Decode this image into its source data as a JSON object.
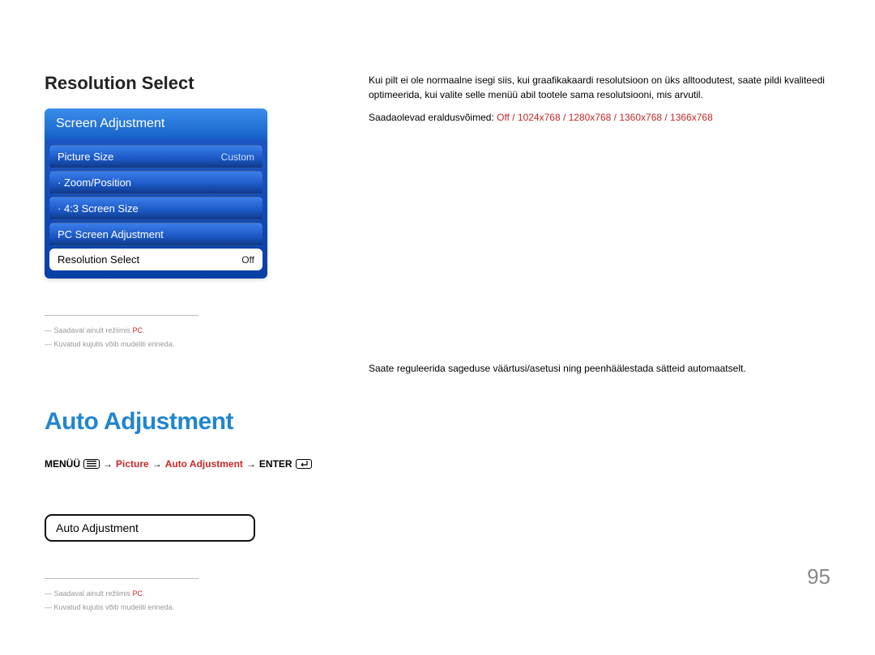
{
  "section1": {
    "title": "Resolution Select",
    "menu": {
      "header": "Screen Adjustment",
      "items": [
        {
          "label": "Picture Size",
          "value": "Custom"
        },
        {
          "label": "· Zoom/Position",
          "value": ""
        },
        {
          "label": "· 4:3 Screen Size",
          "value": ""
        },
        {
          "label": "PC Screen Adjustment",
          "value": ""
        },
        {
          "label": "Resolution Select",
          "value": "Off",
          "selected": true
        }
      ]
    },
    "footnotes": {
      "a_prefix": "― Saadaval ainult režiimis ",
      "a_red": "PC",
      "a_suffix": ".",
      "b": "― Kuvatud kujutis võib mudeliti erineda."
    },
    "body": {
      "p1": "Kui pilt ei ole normaalne isegi siis, kui graafikakaardi resolutsioon on üks alltoodutest, saate pildi kvaliteedi optimeerida, kui valite selle menüü abil tootele sama resolutsiooni, mis arvutil.",
      "p2_prefix": "Saadaolevad eraldusvõimed: ",
      "p2_resolutions": "Off / 1024x768 / 1280x768 / 1360x768 / 1366x768"
    }
  },
  "section2": {
    "title": "Auto Adjustment",
    "breadcrumb": {
      "menu_word": "MENÜÜ",
      "picture": "Picture",
      "auto": "Auto Adjustment",
      "enter": "ENTER"
    },
    "button": "Auto Adjustment",
    "body": "Saate reguleerida sageduse väärtusi/asetusi ning peenhäälestada sätteid automaatselt.",
    "footnotes": {
      "a_prefix": "― Saadaval ainult režiimis ",
      "a_red": "PC",
      "a_suffix": ".",
      "b": "― Kuvatud kujutis võib mudeliti erineda."
    }
  },
  "page_number": "95"
}
